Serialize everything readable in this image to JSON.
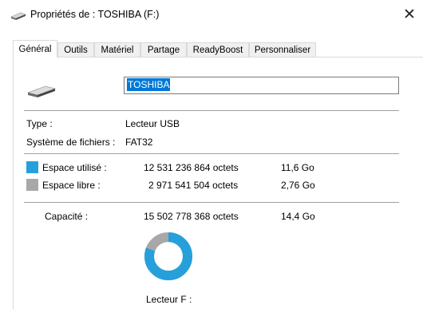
{
  "window": {
    "title": "Propriétés de : TOSHIBA (F:)",
    "close_glyph": "✕",
    "title_icon": "usb-drive-icon"
  },
  "tabs": [
    {
      "label": "Général",
      "active": true
    },
    {
      "label": "Outils",
      "active": false
    },
    {
      "label": "Matériel",
      "active": false
    },
    {
      "label": "Partage",
      "active": false
    },
    {
      "label": "ReadyBoost",
      "active": false
    },
    {
      "label": "Personnaliser",
      "active": false
    }
  ],
  "general": {
    "drive_icon": "usb-drive-icon",
    "volume_name": "TOSHIBA",
    "type_label": "Type :",
    "type_value": "Lecteur USB",
    "fs_label": "Système de fichiers :",
    "fs_value": "FAT32",
    "used": {
      "label": "Espace utilisé :",
      "bytes": "12 531 236 864 octets",
      "size": "11,6 Go",
      "color": "#26a0da"
    },
    "free": {
      "label": "Espace libre :",
      "bytes": "2 971 541 504 octets",
      "size": "2,76 Go",
      "color": "#a8a8a8"
    },
    "capacity": {
      "label": "Capacité :",
      "bytes": "15 502 778 368 octets",
      "size": "14,4 Go"
    },
    "used_fraction": 0.808,
    "drive_label": "Lecteur F :"
  }
}
